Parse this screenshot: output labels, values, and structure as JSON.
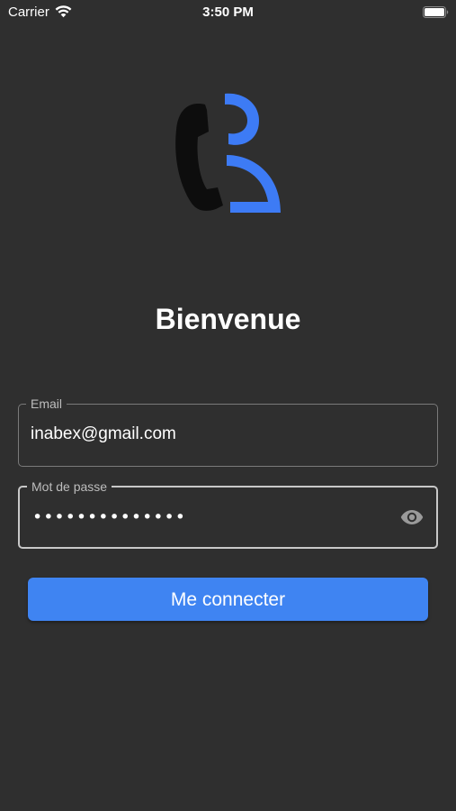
{
  "status_bar": {
    "carrier": "Carrier",
    "time": "3:50 PM",
    "wifi_icon": "wifi-icon",
    "battery_icon": "battery-full-icon"
  },
  "logo": {
    "icon": "phone-user-logo",
    "colors": {
      "handset": "#0d0d0d",
      "accent": "#3d7bf5"
    }
  },
  "title": "Bienvenue",
  "form": {
    "email": {
      "label": "Email",
      "value": "inabex@gmail.com"
    },
    "password": {
      "label": "Mot de passe",
      "value_masked": "••••••••••••••",
      "toggle_icon": "eye-icon"
    },
    "submit_label": "Me connecter"
  },
  "colors": {
    "background": "#2f2f2f",
    "primary": "#3f84f2",
    "border": "#8c8c8c",
    "label": "#bdbdbd"
  }
}
